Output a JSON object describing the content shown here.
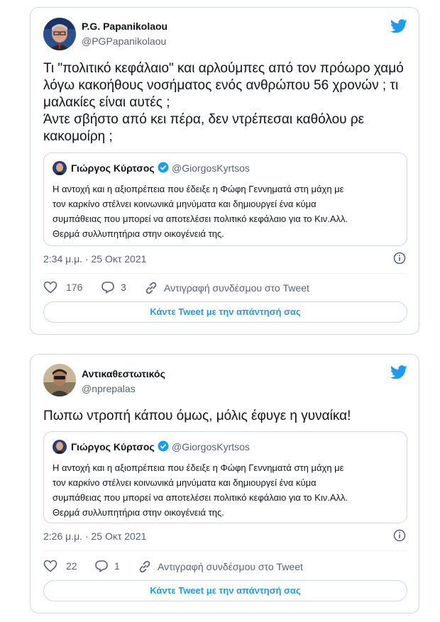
{
  "tweets": [
    {
      "author_name": "P.G. Papanikolaou",
      "author_handle": "@PGPapanikolaou",
      "text": "Τι \"πολιτικό κεφάλαιο\" και αρλούμπες από τον πρόωρο χαμό λόγω κακοήθους νοσήματος ενός ανθρώπου 56 χρονών ; τι μαλακίες είναι αυτές ;\nΆντε σβήστο από κει πέρα, δεν ντρέπεσαι καθόλου ρε κακομοίρη ;",
      "quote": {
        "author_name": "Γιώργος Κύρτσος",
        "author_handle": "@GiorgosKyrtsos",
        "text": "Η αντοχή και η αξιοπρέπεια που έδειξε η Φώφη Γεννηματά στη μάχη με\nτον καρκίνο στέλνει κοινωνικά μηνύματα και δημιουργεί ένα κύμα\nσυμπάθειας που μπορεί να αποτελέσει πολιτικό κεφάλαιο για το Κιν.Αλλ.\nΘερμά συλλυπητήρια στην οικογένειά της."
      },
      "timestamp": "2:34 μ.μ. · 25 Οκτ 2021",
      "likes": "176",
      "replies": "3",
      "copy_link_label": "Αντιγραφή συνδέσμου στο Tweet",
      "reply_label": "Κάντε Tweet με την απάντησή σας"
    },
    {
      "author_name": "Αντικαθεστωτικός",
      "author_handle": "@nprepalas",
      "text": "Πωπω ντροπή κάπου όμως, μόλις έφυγε η γυναίκα!",
      "quote": {
        "author_name": "Γιώργος Κύρτσος",
        "author_handle": "@GiorgosKyrtsos",
        "text": "Η αντοχή και η αξιοπρέπεια που έδειξε η Φώφη Γεννηματά στη μάχη με\nτον καρκίνο στέλνει κοινωνικά μηνύματα και δημιουργεί ένα κύμα\nσυμπάθειας που μπορεί να αποτελέσει πολιτικό κεφάλαιο για το Κιν.Αλλ.\nΘερμά συλλυπητήρια στην οικογένειά της."
      },
      "timestamp": "2:26 μ.μ. · 25 Οκτ 2021",
      "likes": "22",
      "replies": "1",
      "copy_link_label": "Αντιγραφή συνδέσμου στο Tweet",
      "reply_label": "Κάντε Tweet με την απάντησή σας"
    }
  ],
  "colors": {
    "accent": "#1d9bf0",
    "muted": "#536471",
    "border": "#cfd9de"
  },
  "icons": [
    "twitter-bird-icon",
    "verified-badge-icon",
    "info-icon",
    "heart-icon",
    "reply-icon",
    "link-icon"
  ]
}
